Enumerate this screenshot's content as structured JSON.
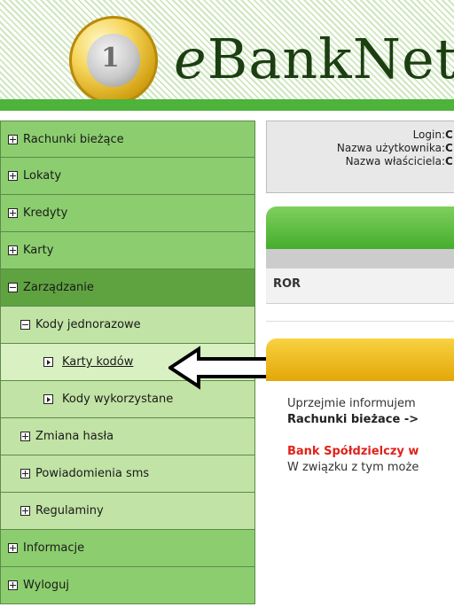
{
  "header": {
    "logo_prefix": "e",
    "logo_rest": "BankNet",
    "coin_text": "1"
  },
  "sidebar": {
    "items": [
      {
        "label": "Rachunki bieżące",
        "icon": "plus-box-icon"
      },
      {
        "label": "Lokaty",
        "icon": "plus-box-icon"
      },
      {
        "label": "Kredyty",
        "icon": "plus-box-icon"
      },
      {
        "label": "Karty",
        "icon": "plus-box-icon"
      },
      {
        "label": "Zarządzanie",
        "icon": "minus-box-icon"
      },
      {
        "label": "Kody jednorazowe",
        "icon": "minus-box-icon"
      },
      {
        "label": "Karty kodów",
        "icon": "triangle-box-icon"
      },
      {
        "label": "Kody wykorzystane",
        "icon": "triangle-box-icon"
      },
      {
        "label": "Zmiana hasła",
        "icon": "plus-box-icon"
      },
      {
        "label": "Powiadomienia sms",
        "icon": "plus-box-icon"
      },
      {
        "label": "Regulaminy",
        "icon": "plus-box-icon"
      },
      {
        "label": "Informacje",
        "icon": "plus-box-icon"
      },
      {
        "label": "Wyloguj",
        "icon": "plus-box-icon"
      }
    ]
  },
  "info": {
    "login_label": "Login:",
    "login_value": "C",
    "username_label": "Nazwa użytkownika:",
    "username_value": "C",
    "owner_label": "Nazwa właściciela:",
    "owner_value": "C"
  },
  "accounts": {
    "row_label": "ROR"
  },
  "message": {
    "line1": "Uprzejmie informujem",
    "line2": "Rachunki bieżace ->",
    "line3": "Bank Spółdzielczy w",
    "line4": "W związku z tym może"
  },
  "colors": {
    "nav_green": "#8cce6f",
    "nav_active": "#5fa341",
    "sub_green": "#c1e3a5",
    "header_green": "#4db33a",
    "yellow": "#f8d240",
    "alert_red": "#e0221b"
  }
}
